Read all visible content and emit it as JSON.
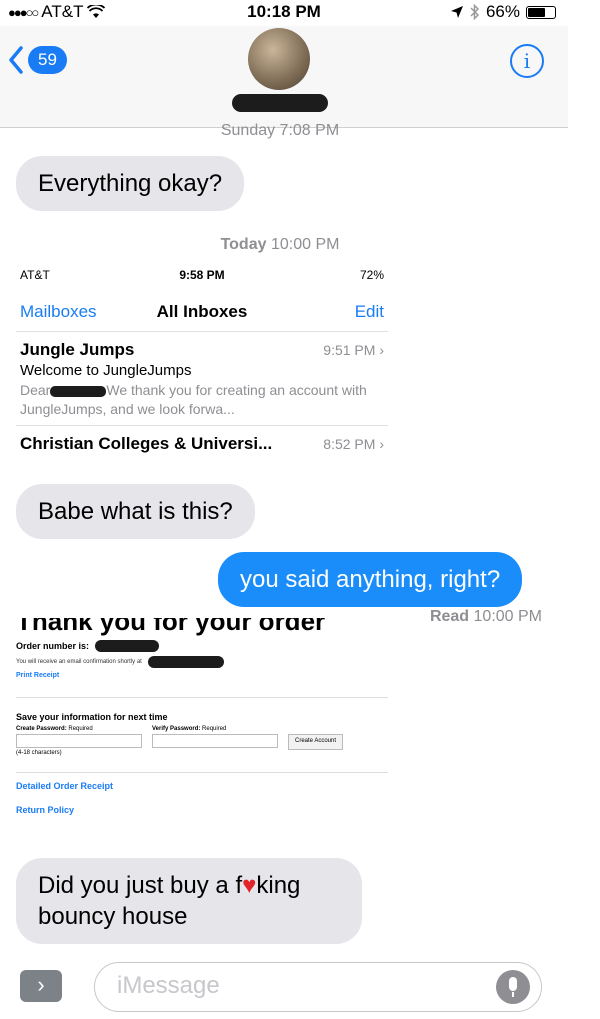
{
  "status_bar": {
    "signal": "●●●○○",
    "carrier": "AT&T",
    "wifi": "wifi-icon",
    "time": "10:18 PM",
    "location": "location-arrow-icon",
    "bluetooth": "bluetooth-icon",
    "battery": "66%",
    "battery_level": 0.66
  },
  "header": {
    "back_count": "59",
    "info": "i"
  },
  "conversation": {
    "timestamp_1": "Sunday 7:08 PM",
    "msg_1": "Everything okay?",
    "timestamp_2_day": "Today",
    "timestamp_2_time": "10:00 PM",
    "msg_2": "Babe what is this?",
    "msg_3": "you said anything, right?",
    "read_label": "Read",
    "read_time": "10:00 PM",
    "msg_4_part1": "Did you just buy a f",
    "msg_4_heart": "♥",
    "msg_4_part2": "king",
    "msg_4_line2": "bouncy house"
  },
  "mail_screenshot": {
    "carrier": "AT&T",
    "time": "9:58 PM",
    "battery": "72%",
    "mailboxes": "Mailboxes",
    "all_inboxes": "All Inboxes",
    "edit": "Edit",
    "items": [
      {
        "sender": "Jungle Jumps",
        "time": "9:51 PM",
        "subject": "Welcome to JungleJumps",
        "preview_start": "Dear",
        "preview_rest": "We thank you for creating an account with JungleJumps, and we look forwa..."
      },
      {
        "sender": "Christian Colleges & Universi...",
        "time": "8:52 PM"
      }
    ]
  },
  "receipt_screenshot": {
    "heading": "Thank you for your order",
    "order_number": "Order number is:",
    "confirmation": "You will receive an email confirmation shortly at",
    "print_receipt": "Print Receipt",
    "save_info": "Save your information for next time",
    "create_password": "Create Password:",
    "verify_password": "Verify Password:",
    "required": "Required",
    "chars": "(4-18 characters)",
    "create_account": "Create Account",
    "detailed_receipt": "Detailed Order Receipt",
    "return_policy": "Return Policy"
  },
  "input_bar": {
    "apps": "›",
    "placeholder": "iMessage"
  }
}
